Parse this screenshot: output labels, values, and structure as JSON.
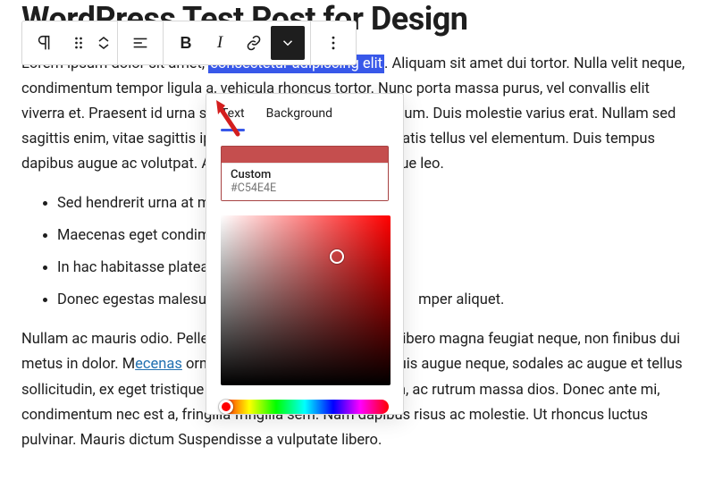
{
  "colors": {
    "custom": "#C54E4E"
  },
  "title": "WordPress Test Post for Design",
  "paragraph1": {
    "pre": "Lorem ipsum dolor sit amet, ",
    "selected": "consectetur adipiscing elit",
    "post": ". Aliquam sit amet dui tortor. Nulla velit neque, condimentum tempor ligula a, vehicula rhoncus tortor. Nunc porta massa purus, vel convallis elit viverra et. Praesent id urna sit amet diam tincidunt vestibulum. Duis molestie varius erat. Nullam sed sagittis enim, vitae sagittis ipsum. Suspendisse non venenatis tellus vel elementum. Duis tempus dapibus augue ac volutpat. Aliquam id laoreet est pentesque leo."
  },
  "bullets": [
    "Sed hendrerit urna at m",
    "Maecenas eget condimentum",
    "In hac habitasse platea dictumst",
    "Donec egestas malesuada"
  ],
  "bullet_tail": "mper aliquet.",
  "paragraph2": {
    "pre": "Nullam ac mauris odio. Pellentesque vehicula nia tempor, libero magna feugiat neque, non finibus dui metus in dolor. M",
    "link": "ecenas",
    "post": " ornare in tellus vel fermentum. Duis augue neque, sodales ac augue et tellus sollicitudin, ex eget tristique posuere, leo nisi tempor lorem, ac rutrum massa dios. Donec ante mi, condimentum nec est a, fringilla fringilla sem. Nam dapibus risus ac molestie. Ut rhoncus luctus pulvinar. Mauris dictum Suspendisse a vulputate libero."
  },
  "popover": {
    "tab_text": "Text",
    "tab_bg": "Background",
    "custom_label": "Custom",
    "custom_hex": "#C54E4E"
  }
}
